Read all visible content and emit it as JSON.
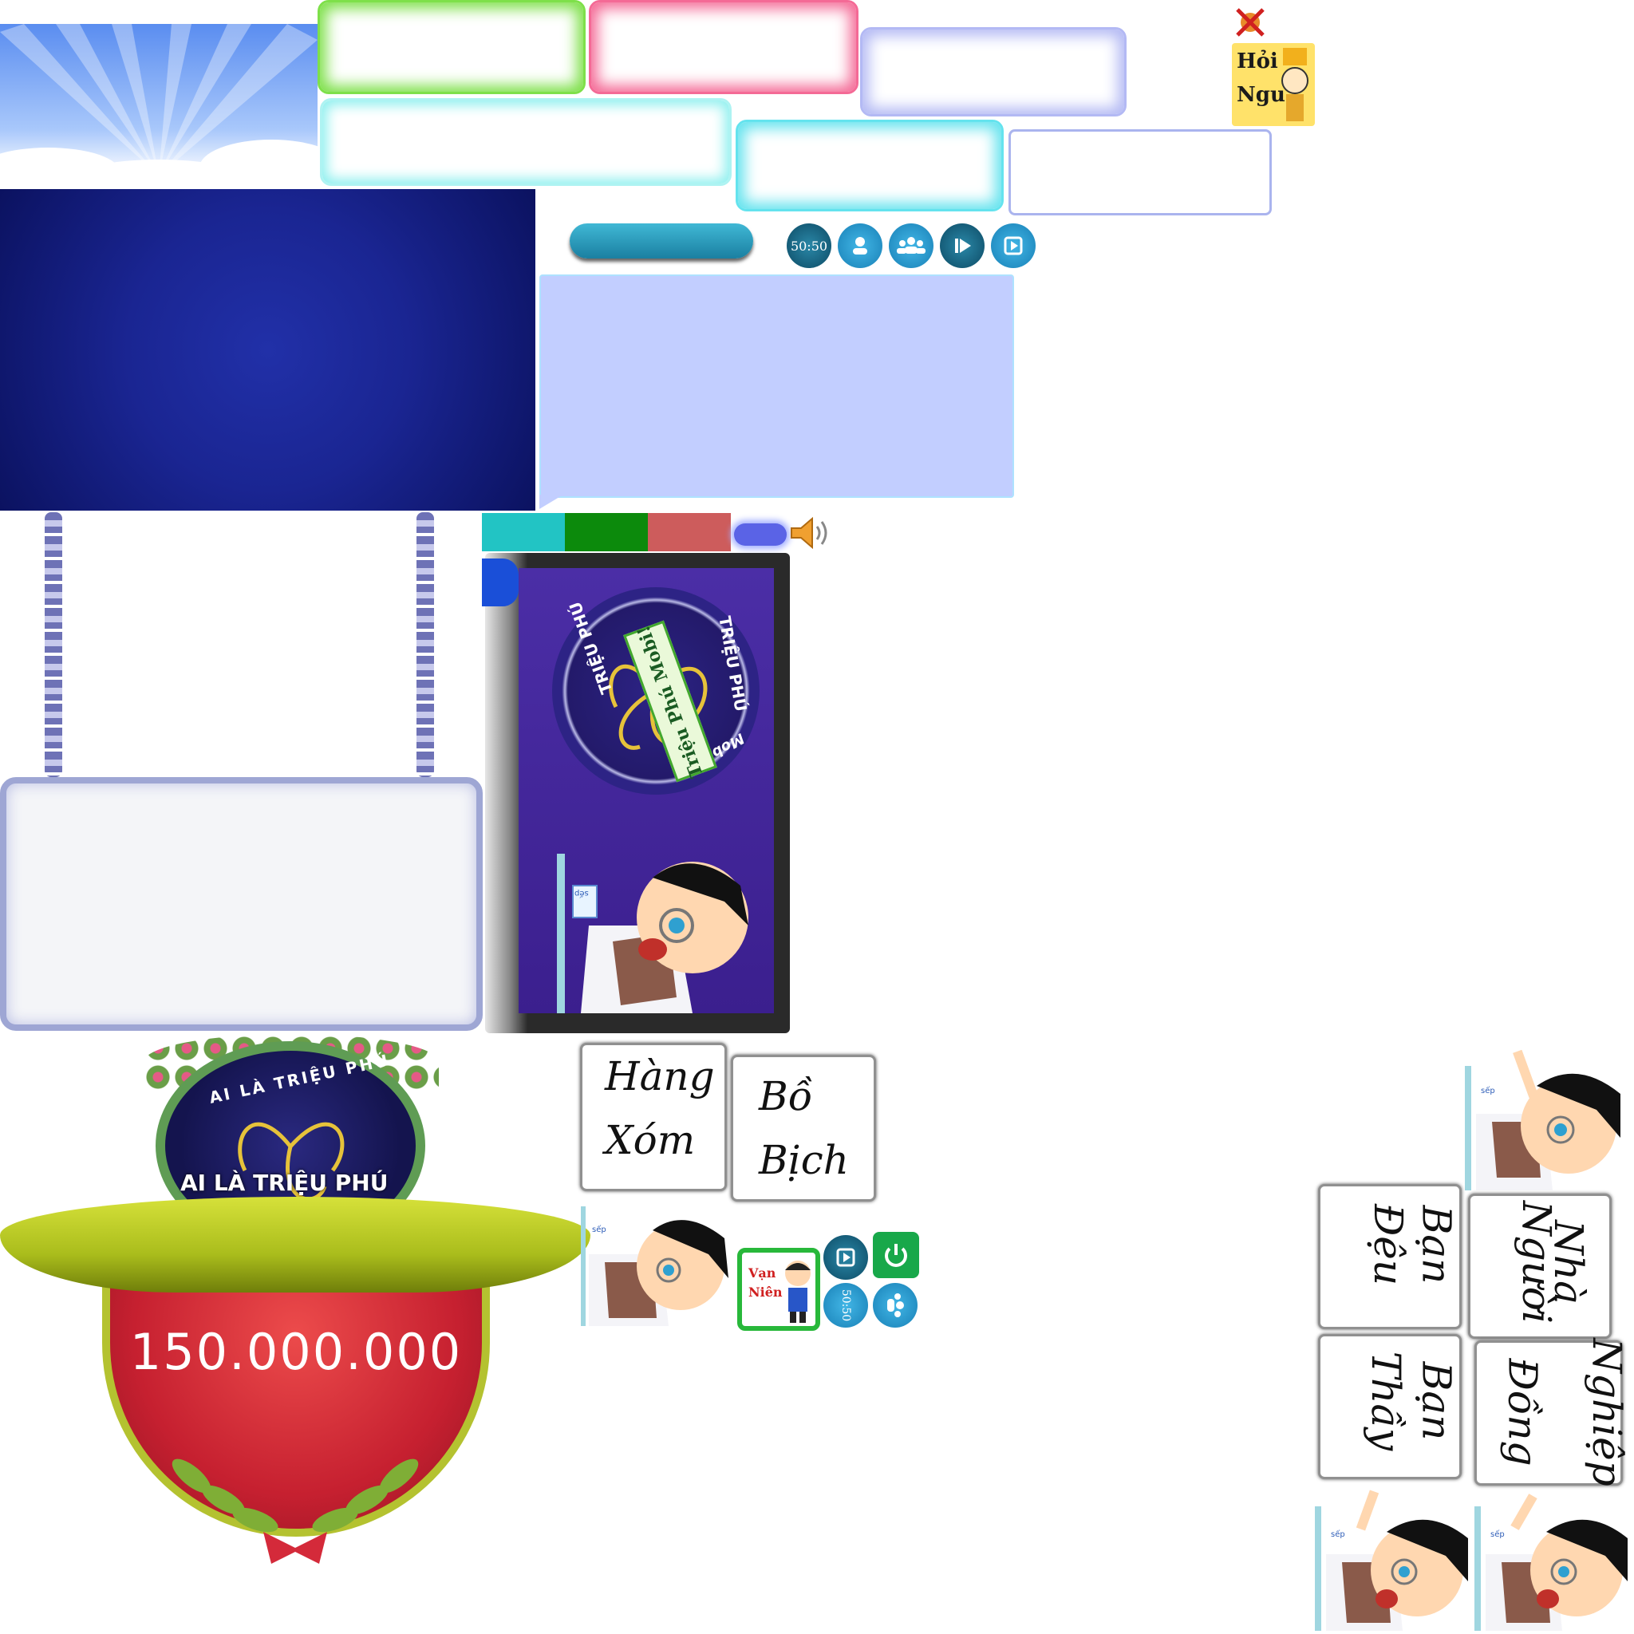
{
  "badge": {
    "ring_top": "AI LÀ TRIỆU PHÚ",
    "ring_center": "AI LÀ TRIỆU PHÚ",
    "prize": "150.000.000"
  },
  "hoi_ngu": {
    "line1": "Hỏi",
    "line2": "Ngu"
  },
  "lifelines": {
    "fifty_fifty": "50:50",
    "fifty_fifty_small": "50:50"
  },
  "splash": {
    "ribbon_text": "Triệu Phú Mobi!",
    "ring_text_left": "TRIỆU PHÚ",
    "ring_text_right": "TRIỆU PHÚ",
    "ring_text_bottom": "Mobile",
    "card_label": "sếp"
  },
  "cards": [
    {
      "line1": "Hàng",
      "line2": "Xóm"
    },
    {
      "line1": "Bồ",
      "line2": "Bịch"
    },
    {
      "line1": "Đệu",
      "line2": "Bạn"
    },
    {
      "line1": "Người",
      "line2": "Nhà"
    },
    {
      "line1": "Thầy",
      "line2": "Bạn"
    },
    {
      "line1": "Đồng",
      "line2": "Nghiệp"
    }
  ],
  "van_nien": {
    "line1": "Vạn",
    "line2": "Niên"
  },
  "character_card_label": "sếp",
  "colors": {
    "teal_swatch": "#22c4c4",
    "green_swatch": "#0c8a0c",
    "red_swatch": "#cd5c5c",
    "frame_green": "#7ee04a",
    "frame_pink": "#f46a96",
    "frame_cyan": "#64e3ee",
    "panel_blue": "#1a2592",
    "question_box": "#c2ceff",
    "prize_red": "#c62030",
    "banner_yellow": "#c9d62c"
  },
  "icons": [
    "person-icon",
    "audience-icon",
    "skip-icon",
    "switch-icon",
    "sound-icon",
    "close-icon",
    "power-icon"
  ]
}
